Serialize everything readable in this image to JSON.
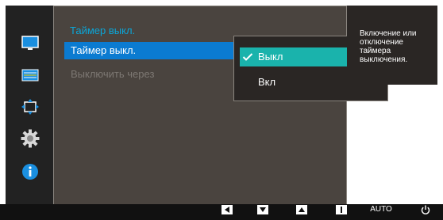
{
  "colors": {
    "highlight_blue": "#0b7bd1",
    "title_blue": "#0aa6d8",
    "selection_teal": "#1ab3ac",
    "panel_bg": "#4a443f",
    "popup_bg": "#2a2624"
  },
  "sidebar": {
    "icons": [
      "monitor-icon",
      "picture-settings-icon",
      "resize-arrows-icon",
      "gear-icon",
      "info-icon"
    ]
  },
  "menu": {
    "title": "Таймер выкл.",
    "items": [
      {
        "label": "Таймер выкл.",
        "state": "selected"
      },
      {
        "label": "Выключить через",
        "state": "disabled"
      }
    ]
  },
  "popup": {
    "options": [
      {
        "label": "Выкл",
        "checked": true
      },
      {
        "label": "Вкл",
        "checked": false
      }
    ]
  },
  "help": {
    "text": "Включение или отключение таймера выключения."
  },
  "bottom_bar": {
    "auto_label": "AUTO",
    "buttons": [
      "left-arrow-button-icon",
      "down-arrow-button-icon",
      "up-arrow-button-icon",
      "enter-button-icon",
      "auto-button",
      "power-icon"
    ]
  }
}
